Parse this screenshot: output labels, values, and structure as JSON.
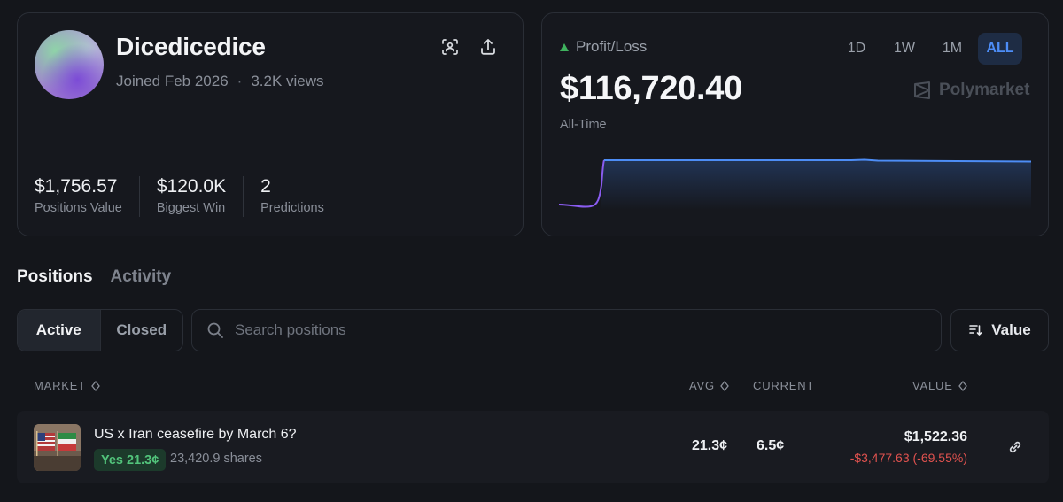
{
  "profile": {
    "username": "Dicedicedice",
    "joined": "Joined Feb 2026",
    "separator": "·",
    "views": "3.2K views",
    "stats": [
      {
        "value": "$1,756.57",
        "label": "Positions Value"
      },
      {
        "value": "$120.0K",
        "label": "Biggest Win"
      },
      {
        "value": "2",
        "label": "Predictions"
      }
    ]
  },
  "pnl": {
    "label": "Profit/Loss",
    "value": "$116,720.40",
    "period_label": "All-Time",
    "ranges": [
      "1D",
      "1W",
      "1M",
      "ALL"
    ],
    "active_range": "ALL",
    "brand": "Polymarket",
    "colors": {
      "up": "#3fb25e",
      "line": "#4d8df6",
      "active_bg": "#1e2c44"
    }
  },
  "sections": {
    "tabs": [
      "Positions",
      "Activity"
    ],
    "active": "Positions"
  },
  "filters": {
    "status": [
      "Active",
      "Closed"
    ],
    "active_status": "Active",
    "search_placeholder": "Search positions",
    "sort_label": "Value"
  },
  "table": {
    "headers": {
      "market": "MARKET",
      "avg": "AVG",
      "current": "CURRENT",
      "value": "VALUE"
    },
    "rows": [
      {
        "title": "US x Iran ceasefire by March 6?",
        "outcome": "Yes 21.3¢",
        "shares": "23,420.9 shares",
        "avg": "21.3¢",
        "current": "6.5¢",
        "value": "$1,522.36",
        "pnl": "-$3,477.63 (-69.55%)"
      }
    ]
  }
}
